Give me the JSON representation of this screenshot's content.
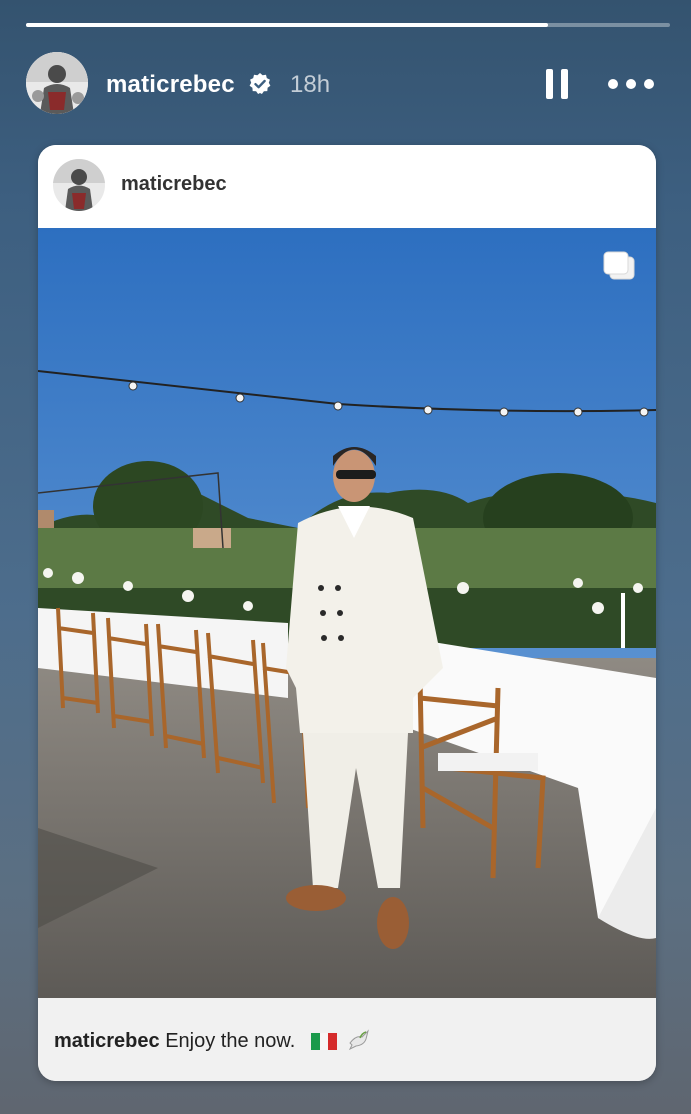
{
  "story": {
    "progress": 0.81,
    "username": "maticrebec",
    "verified": true,
    "timestamp": "18h",
    "pause_icon": "pause-icon",
    "more_icon": "more-options-icon"
  },
  "post": {
    "username": "maticrebec",
    "carousel_icon": "carousel-icon",
    "caption_user": "maticrebec",
    "caption_text": "Enjoy the now.",
    "caption_emojis": [
      "italy-flag",
      "dove"
    ]
  },
  "colors": {
    "background_top": "#34536f",
    "background_bottom": "#5f6670",
    "verified_badge": "#ffffff"
  }
}
